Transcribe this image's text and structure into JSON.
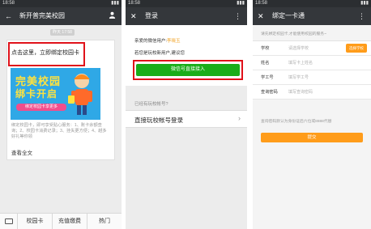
{
  "panel1": {
    "status_time": "18:58",
    "nav": {
      "back_icon": "arrow-left-icon",
      "title": "新开普完美校园",
      "right_icon": "person-icon"
    },
    "time_pill": "昨天 17:58",
    "article": {
      "title": "点击这里，立即绑定校园卡",
      "banner_line1": "完美校园",
      "banner_line2": "绑卡开启",
      "banner_sub": "绑定校园卡享更多",
      "description": "绑定校园卡，即可享受贴心服务：1、账卡余额查询；2、校园卡消费记录；3、挂失更方便；4、越多好礼等你领",
      "read_more": "查看全文"
    },
    "bottom_tabs": [
      "校园卡",
      "充值缴费",
      "热门"
    ]
  },
  "panel2": {
    "status_time": "18:58",
    "nav": {
      "close_icon": "close-icon",
      "title": "登录",
      "more_icon": "more-vertical-icon"
    },
    "greeting_prefix": "亲爱的微信用户:",
    "username": "李晓玉",
    "new_user_prompt": "若您是玩校新用户,建议您",
    "wechat_login_button": "微信号直接接入",
    "have_account_prompt": "已经有玩校帐号?",
    "direct_login_row": "直接玩校帐号登录",
    "arrow_icon": "chevron-right-icon"
  },
  "panel3": {
    "status_time": "18:58",
    "nav": {
      "close_icon": "close-icon",
      "title": "绑定一卡通",
      "more_icon": "more-vertical-icon"
    },
    "top_tip": "请先绑定校园卡,才能使用校园的服务~",
    "fields": [
      {
        "label": "学校",
        "placeholder": "请选择学校",
        "button": "选择学校"
      },
      {
        "label": "姓名",
        "placeholder": "填写卡上姓名"
      },
      {
        "label": "学工号",
        "placeholder": "填写学工号"
      },
      {
        "label": "查询密码",
        "placeholder": "填写查询密码"
      }
    ],
    "bottom_note": "查询密码默认为身份证后六位或8888代替",
    "submit_button": "提交"
  },
  "colors": {
    "nav_bg": "#34373b",
    "highlight_red": "#e0121a",
    "wechat_green": "#1aad19",
    "accent_orange": "#ff9c1a",
    "banner_blue": "#2fa8e6"
  }
}
